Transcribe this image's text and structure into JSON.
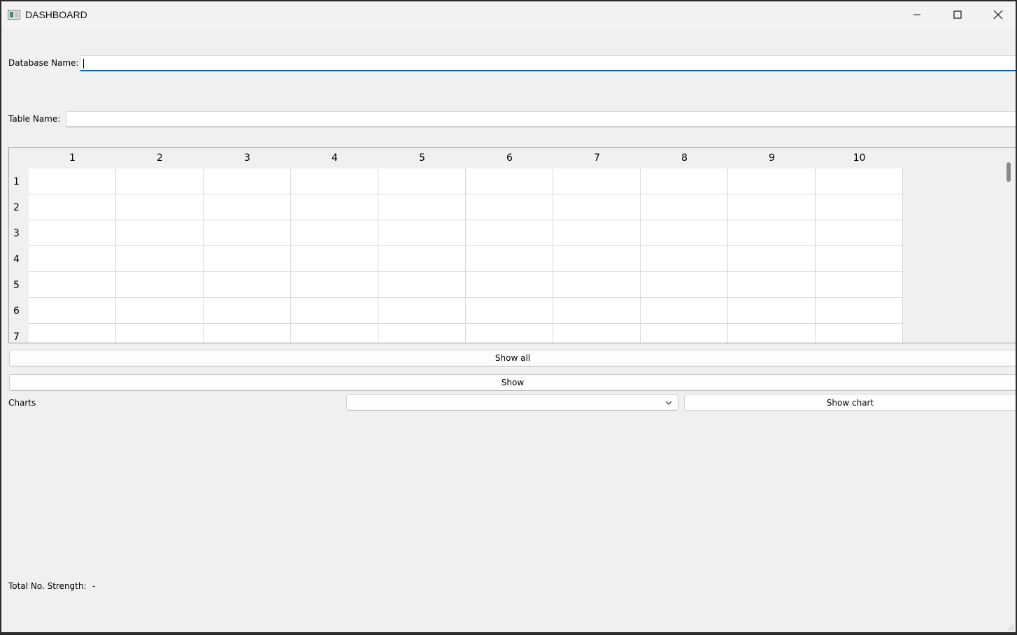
{
  "window": {
    "title": "DASHBOARD"
  },
  "form": {
    "database_label": "Database Name:",
    "database_value": "",
    "table_label": "Table Name:",
    "table_value": ""
  },
  "table": {
    "columns": [
      "1",
      "2",
      "3",
      "4",
      "5",
      "6",
      "7",
      "8",
      "9",
      "10"
    ],
    "rows": [
      "1",
      "2",
      "3",
      "4",
      "5",
      "6",
      "7"
    ]
  },
  "buttons": {
    "show_all": "Show all",
    "show": "Show",
    "show_chart": "Show chart"
  },
  "charts": {
    "label": "Charts",
    "selected": ""
  },
  "footer": {
    "strength_label": "Total No. Strength:",
    "strength_value": "-"
  },
  "icons": {
    "app": "app-window-icon",
    "minimize": "minimize-icon",
    "maximize": "maximize-icon",
    "close": "close-icon",
    "dropdown": "chevron-down-icon"
  }
}
